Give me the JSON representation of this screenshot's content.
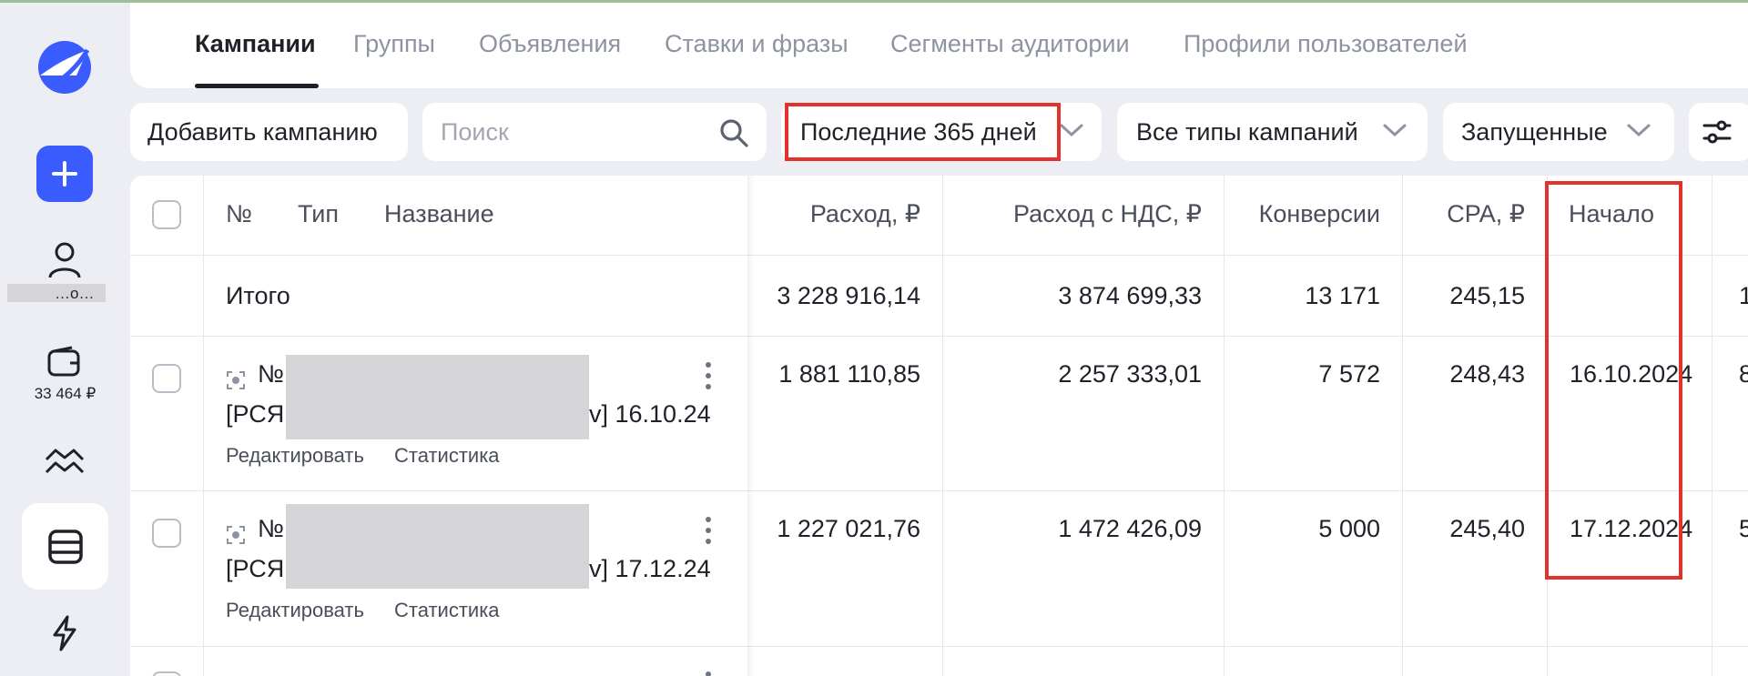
{
  "sidebar": {
    "user_label": "…о…",
    "wallet_amount": "33 464 ₽"
  },
  "tabs": [
    {
      "label": "Кампании",
      "active": true
    },
    {
      "label": "Группы"
    },
    {
      "label": "Объявления"
    },
    {
      "label": "Ставки и фразы"
    },
    {
      "label": "Сегменты аудитории"
    },
    {
      "label": "Профили пользователей"
    }
  ],
  "toolbar": {
    "add_campaign_label": "Добавить кампанию",
    "search_placeholder": "Поиск",
    "period_label": "Последние 365 дней",
    "types_label": "Все типы кампаний",
    "status_label": "Запущенные"
  },
  "table": {
    "headers": {
      "num": "№",
      "type": "Тип",
      "name": "Название",
      "spend": "Расход, ₽",
      "spend_vat": "Расход с НДС, ₽",
      "conversions": "Конверсии",
      "cpa": "CPA, ₽",
      "start": "Начало"
    },
    "total": {
      "label": "Итого",
      "spend": "3 228 916,14",
      "spend_vat": "3 874 699,33",
      "conversions": "13 171",
      "cpa": "245,15",
      "next_col": "1"
    },
    "rows": [
      {
        "num_prefix": "№",
        "name_start": "[РСЯ",
        "name_end": "v] 16.10.24",
        "edit_label": "Редактировать",
        "stats_label": "Статистика",
        "spend": "1 881 110,85",
        "spend_vat": "2 257 333,01",
        "conversions": "7 572",
        "cpa": "248,43",
        "start": "16.10.2024",
        "next_col": "8"
      },
      {
        "num_prefix": "№",
        "name_start": "[РСЯ",
        "name_end": "v] 17.12.24",
        "edit_label": "Редактировать",
        "stats_label": "Статистика",
        "spend": "1 227 021,76",
        "spend_vat": "1 472 426,09",
        "conversions": "5 000",
        "cpa": "245,40",
        "start": "17.12.2024",
        "next_col": "5"
      }
    ]
  },
  "colors": {
    "accent": "#3a5cff",
    "highlight": "#e1322c"
  }
}
